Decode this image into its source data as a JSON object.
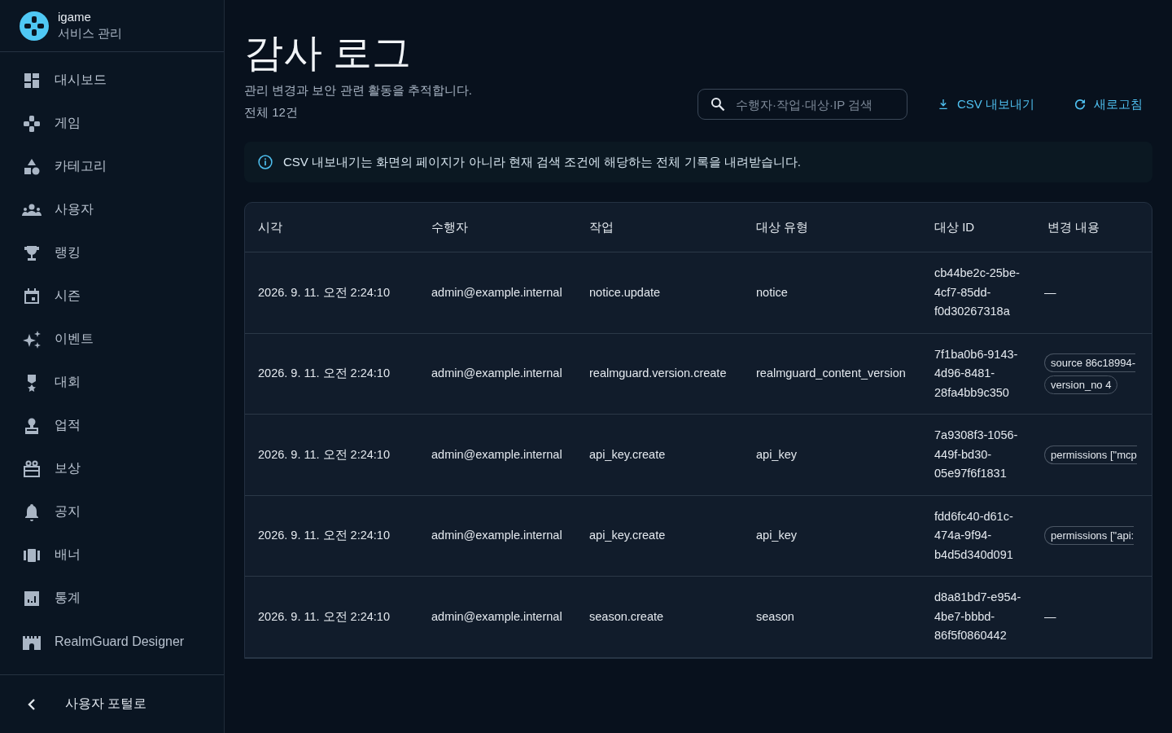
{
  "brand": {
    "name": "igame",
    "subtitle": "서비스 관리"
  },
  "sidebar": {
    "items": [
      {
        "label": "대시보드"
      },
      {
        "label": "게임"
      },
      {
        "label": "카테고리"
      },
      {
        "label": "사용자"
      },
      {
        "label": "랭킹"
      },
      {
        "label": "시즌"
      },
      {
        "label": "이벤트"
      },
      {
        "label": "대회"
      },
      {
        "label": "업적"
      },
      {
        "label": "보상"
      },
      {
        "label": "공지"
      },
      {
        "label": "배너"
      },
      {
        "label": "통계"
      },
      {
        "label": "RealmGuard Designer"
      }
    ],
    "back_link": "사용자 포털로"
  },
  "page": {
    "title": "감사 로그",
    "description": "관리 변경과 보안 관련 활동을 추적합니다.",
    "total": "전체 12건"
  },
  "search": {
    "placeholder": "수행자·작업·대상·IP 검색"
  },
  "actions": [
    "CSV 내보내기",
    "새로고침"
  ],
  "info_banner": "CSV 내보내기는 화면의 페이지가 아니라 현재 검색 조건에 해당하는 전체 기록을 내려받습니다.",
  "table": {
    "columns": [
      "시각",
      "수행자",
      "작업",
      "대상 유형",
      "대상 ID",
      "변경 내용"
    ],
    "rows": [
      {
        "time": "2026. 9. 11. 오전 2:24:10",
        "actor": "admin@example.internal",
        "action": "notice.update",
        "target_type": "notice",
        "target_id": "cb44be2c-25be-4cf7-85dd-f0d30267318a",
        "changes": [],
        "empty": "—"
      },
      {
        "time": "2026. 9. 11. 오전 2:24:10",
        "actor": "admin@example.internal",
        "action": "realmguard.version.create",
        "target_type": "realmguard_content_version",
        "target_id": "7f1ba0b6-9143-4d96-8481-28fa4bb9c350",
        "changes": [
          {
            "text": "source 86c18994-",
            "clipped": true
          },
          {
            "text": "version_no 4",
            "clipped": false
          }
        ]
      },
      {
        "time": "2026. 9. 11. 오전 2:24:10",
        "actor": "admin@example.internal",
        "action": "api_key.create",
        "target_type": "api_key",
        "target_id": "7a9308f3-1056-449f-bd30-05e97f6f1831",
        "changes": [
          {
            "text": "permissions [\"mcp",
            "clipped": true
          }
        ]
      },
      {
        "time": "2026. 9. 11. 오전 2:24:10",
        "actor": "admin@example.internal",
        "action": "api_key.create",
        "target_type": "api_key",
        "target_id": "fdd6fc40-d61c-474a-9f94-b4d5d340d091",
        "changes": [
          {
            "text": "permissions [\"api:",
            "clipped": true
          }
        ]
      },
      {
        "time": "2026. 9. 11. 오전 2:24:10",
        "actor": "admin@example.internal",
        "action": "season.create",
        "target_type": "season",
        "target_id": "d8a81bd7-e954-4be7-bbbd-86f5f0860442",
        "changes": [],
        "empty": "—"
      }
    ]
  }
}
